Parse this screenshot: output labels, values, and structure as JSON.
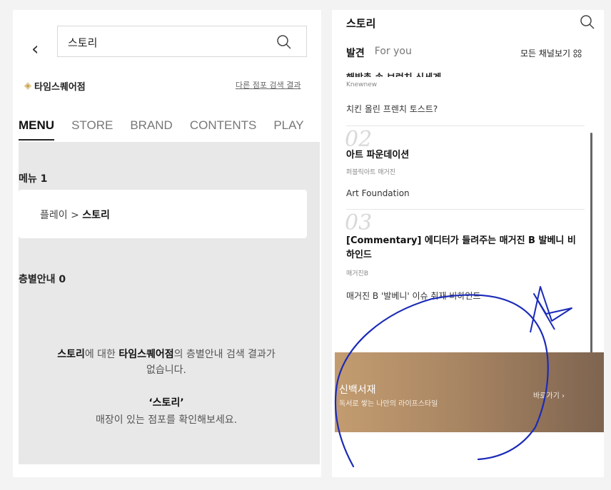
{
  "left": {
    "search": {
      "value": "스토리"
    },
    "store": {
      "name": "타임스퀘어점",
      "other_results": "다른 점포 검색 결과"
    },
    "tabs": [
      "MENU",
      "STORE",
      "BRAND",
      "CONTENTS",
      "PLAY"
    ],
    "menu_section": {
      "title_prefix": "메뉴",
      "count": "1",
      "path_prefix": "플레이 >",
      "path_current": "스토리"
    },
    "floor_section": {
      "title_prefix": "층별안내",
      "count": "0"
    },
    "empty": {
      "keyword": "스토리",
      "text1": "에 대한 ",
      "store": "타임스퀘어점",
      "text2": "의 층별안내 검색 결과가",
      "line2": "없습니다.",
      "quote": "‘스토리’",
      "tip": "매장이 있는 점포를 확인해보세요."
    }
  },
  "right": {
    "title": "스토리",
    "tabs": [
      "발견",
      "For you"
    ],
    "all_channels": "모든 채널보기",
    "items": [
      {
        "title": "해방촌 속 브런치 신세계",
        "source": "Knewnew",
        "desc": "치킨 올린 프렌치 토스트?"
      },
      {
        "number": "02",
        "title": "아트 파운데이션",
        "source": "퍼블릭아트 매거진",
        "desc": "Art Foundation"
      },
      {
        "number": "03",
        "title_line1": "[Commentary] 에디터가 들려주는 매거진 B 발베니 비",
        "title_line2": "하인드",
        "source": "매거진B",
        "desc": "매거진 B '발베니' 이슈 취재 비하인드"
      }
    ],
    "banner": {
      "title": "신백서재",
      "subtitle": "독서로 쌓는 나만의 라이프스타일",
      "link": "바로가기 ›"
    }
  },
  "colors": {
    "accent_gold": "#c9a24a",
    "banner": "#a98663",
    "scribble": "#1b2bb8",
    "panel_gray": "#e8e8e8"
  },
  "icons": [
    "back-arrow-icon",
    "search-icon",
    "location-pin-icon",
    "grid-icon"
  ]
}
